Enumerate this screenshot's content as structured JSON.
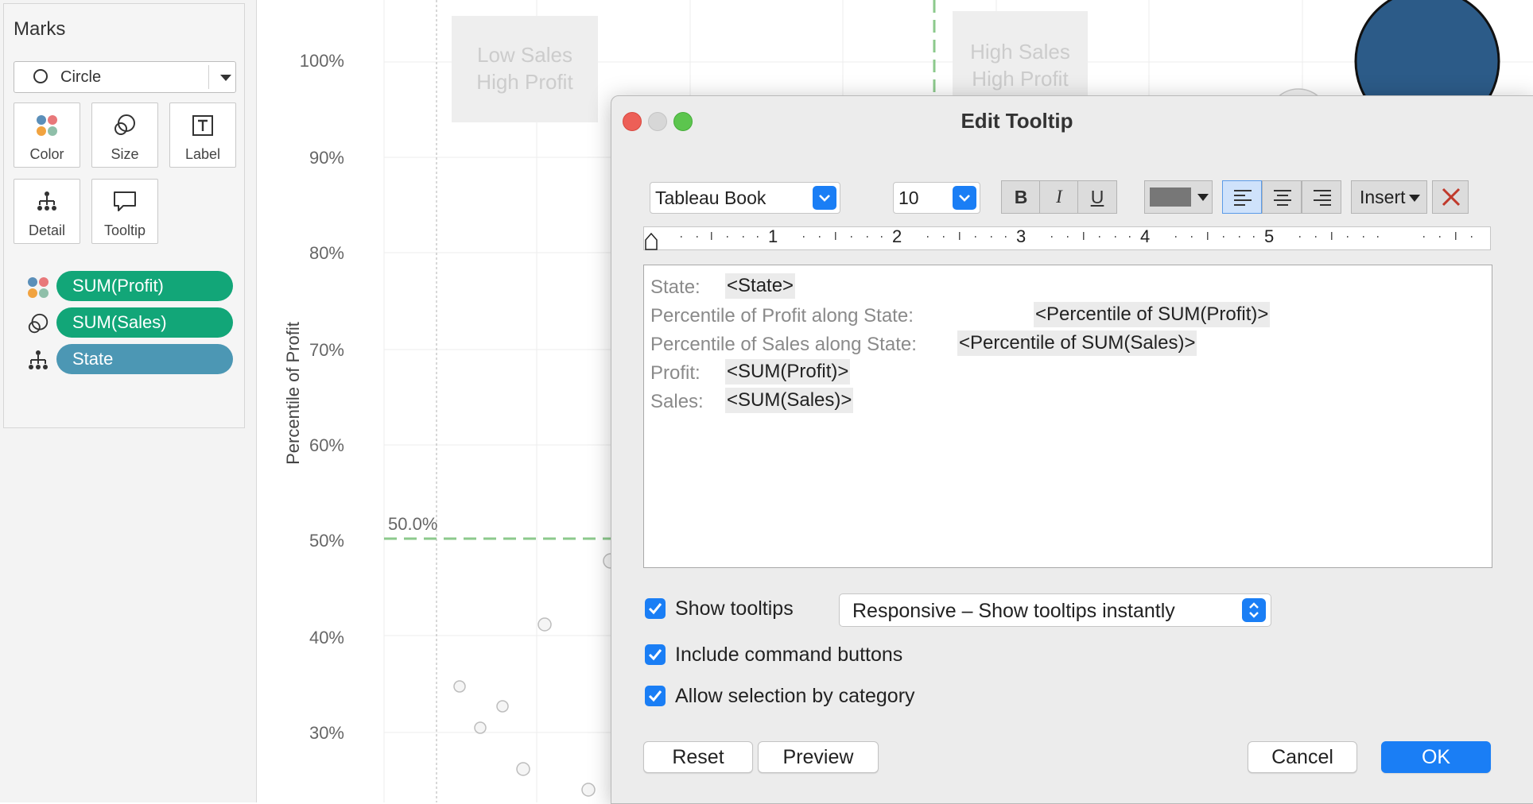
{
  "marks": {
    "title": "Marks",
    "mark_type": "Circle",
    "buttons": [
      {
        "label": "Color",
        "icon": "color-dots-icon"
      },
      {
        "label": "Size",
        "icon": "size-circles-icon"
      },
      {
        "label": "Label",
        "icon": "label-t-icon"
      },
      {
        "label": "Detail",
        "icon": "detail-hierarchy-icon"
      },
      {
        "label": "Tooltip",
        "icon": "tooltip-speech-icon"
      }
    ],
    "pills": [
      {
        "label": "SUM(Profit)",
        "icon": "color-dots-icon",
        "color": "#12a678"
      },
      {
        "label": "SUM(Sales)",
        "icon": "size-circles-icon",
        "color": "#12a678"
      },
      {
        "label": "State",
        "icon": "detail-hierarchy-icon",
        "color": "#4c97b4"
      }
    ]
  },
  "chart": {
    "y_axis_title": "Percentile of Profit",
    "y_ticks": [
      "100%",
      "90%",
      "80%",
      "70%",
      "60%",
      "50%",
      "40%",
      "30%"
    ],
    "reference_line_label": "50.0%",
    "quadrant_low_sales": "Low Sales\nHigh Profit",
    "quadrant_high_sales": "High Sales\nHigh Profit",
    "reference_line_color": "#8cc98c"
  },
  "dialog": {
    "title": "Edit Tooltip",
    "font": "Tableau Book",
    "font_size": "10",
    "bold": "B",
    "italic": "I",
    "underline": "U",
    "insert_label": "Insert",
    "ruler_numbers": [
      "1",
      "2",
      "3",
      "4",
      "5"
    ],
    "editor_lines": [
      {
        "label": "State:",
        "field": "<State>"
      },
      {
        "label": "Percentile of Profit along State:",
        "field": "<Percentile of SUM(Profit)>"
      },
      {
        "label": "Percentile of Sales along State:",
        "field": "<Percentile of SUM(Sales)>"
      },
      {
        "label": "Profit:",
        "field": "<SUM(Profit)>"
      },
      {
        "label": "Sales:",
        "field": "<SUM(Sales)>"
      }
    ],
    "show_tooltips": "Show tooltips",
    "show_tooltips_checked": true,
    "tooltip_mode": "Responsive – Show tooltips instantly",
    "include_command_buttons": "Include command buttons",
    "include_command_buttons_checked": true,
    "allow_selection": "Allow selection by category",
    "allow_selection_checked": true,
    "reset": "Reset",
    "preview": "Preview",
    "cancel": "Cancel",
    "ok": "OK",
    "accent": "#1a7ef5"
  }
}
